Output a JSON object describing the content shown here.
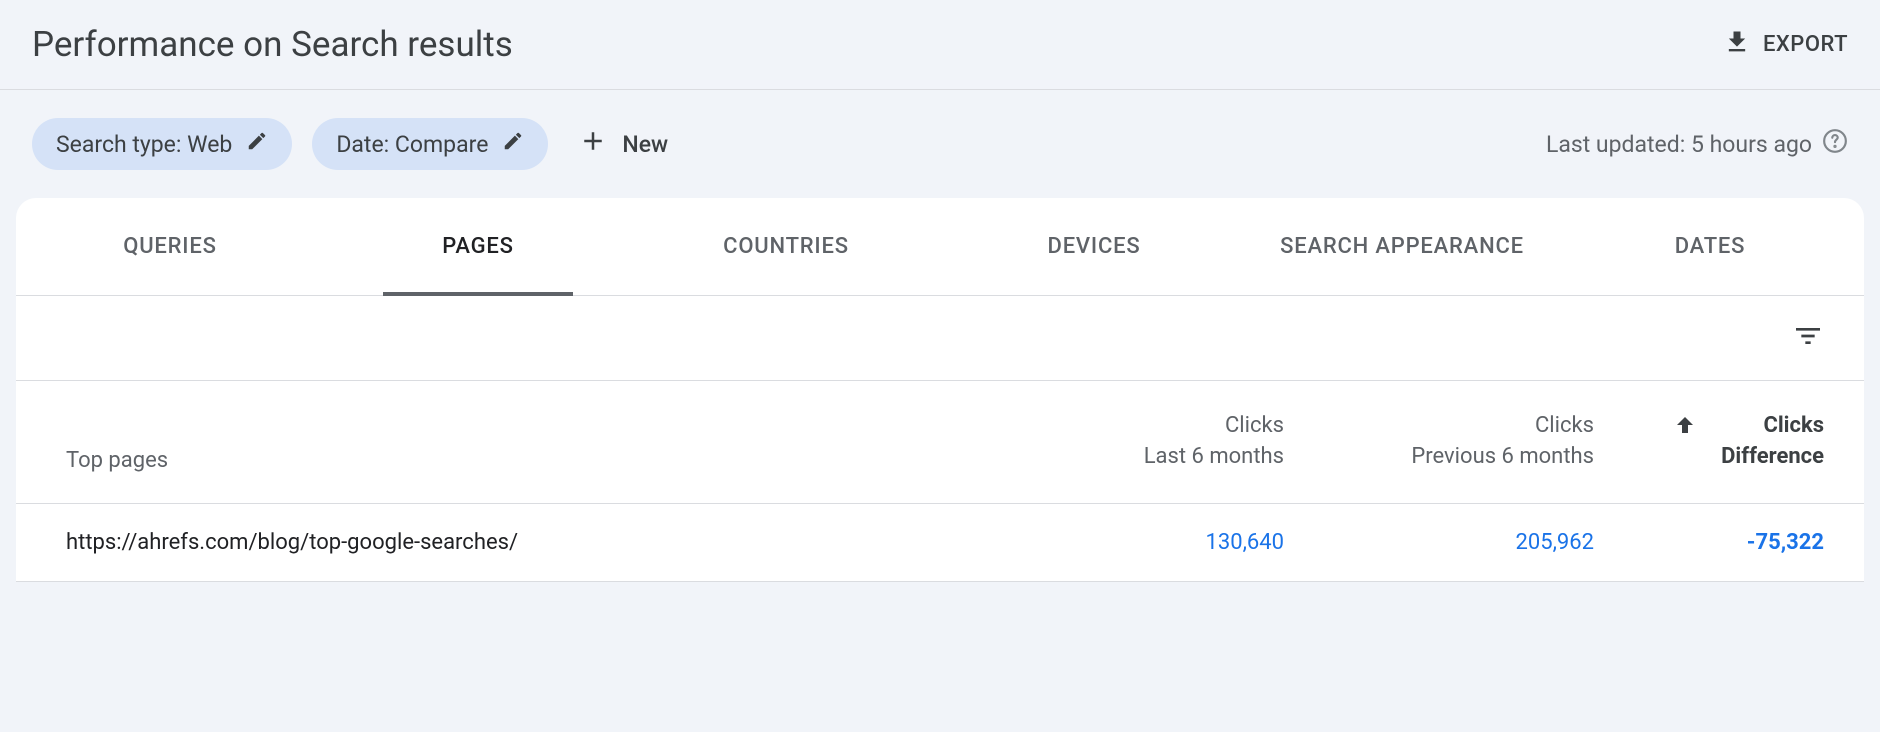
{
  "header": {
    "title": "Performance on Search results",
    "export_label": "EXPORT"
  },
  "filters": {
    "search_type_chip": "Search type: Web",
    "date_chip": "Date: Compare",
    "new_label": "New",
    "last_updated": "Last updated: 5 hours ago"
  },
  "tabs": [
    {
      "label": "QUERIES",
      "active": false
    },
    {
      "label": "PAGES",
      "active": true
    },
    {
      "label": "COUNTRIES",
      "active": false
    },
    {
      "label": "DEVICES",
      "active": false
    },
    {
      "label": "SEARCH APPEARANCE",
      "active": false
    },
    {
      "label": "DATES",
      "active": false
    }
  ],
  "table": {
    "columns": {
      "page_label": "Top pages",
      "col1_line1": "Clicks",
      "col1_line2": "Last 6 months",
      "col2_line1": "Clicks",
      "col2_line2": "Previous 6 months",
      "col3_line1": "Clicks",
      "col3_line2": "Difference"
    },
    "rows": [
      {
        "page": "https://ahrefs.com/blog/top-google-searches/",
        "clicks_current": "130,640",
        "clicks_previous": "205,962",
        "difference": "-75,322"
      }
    ]
  }
}
